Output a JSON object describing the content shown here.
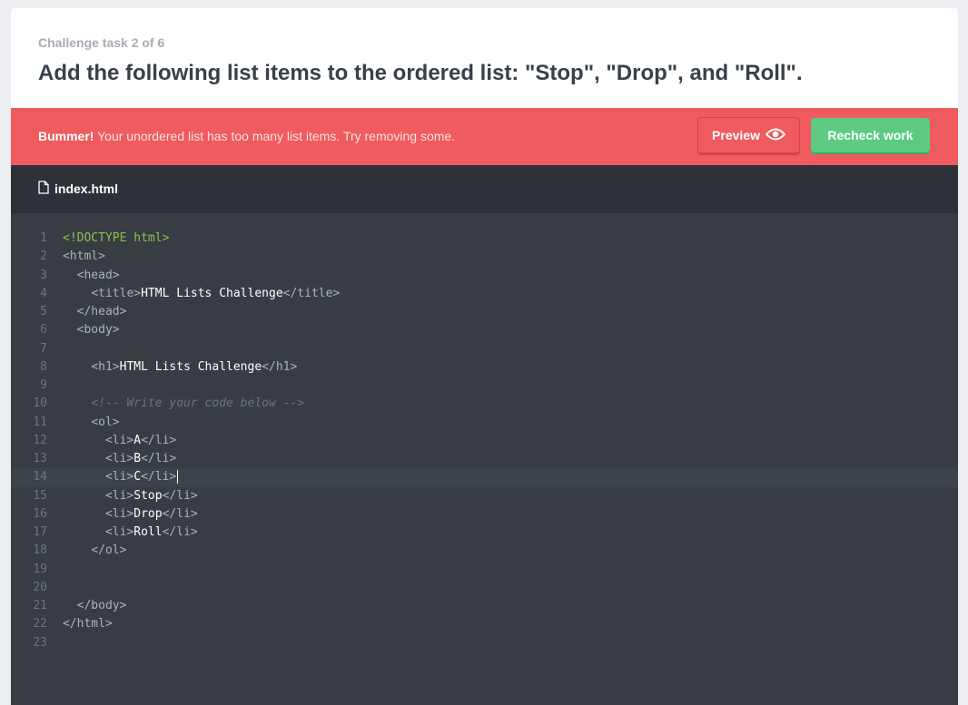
{
  "challenge": {
    "task_label": "Challenge task 2 of 6",
    "title": "Add the following list items to the ordered list: \"Stop\", \"Drop\", and \"Roll\"."
  },
  "alert": {
    "strong": "Bummer!",
    "message": " Your unordered list has too many list items. Try removing some.",
    "preview_label": "Preview",
    "preview_icon": "eye-icon",
    "recheck_label": "Recheck work",
    "color": "#ef5b5e"
  },
  "file": {
    "name": "index.html",
    "icon": "file-icon"
  },
  "editor": {
    "active_line": 14,
    "lines": [
      {
        "n": "1",
        "indent": "",
        "parts": [
          {
            "c": "doc",
            "t": "<!DOCTYPE html>"
          }
        ]
      },
      {
        "n": "2",
        "indent": "",
        "parts": [
          {
            "c": "tag",
            "t": "<html>"
          }
        ]
      },
      {
        "n": "3",
        "indent": "  ",
        "parts": [
          {
            "c": "tag",
            "t": "<head>"
          }
        ]
      },
      {
        "n": "4",
        "indent": "    ",
        "parts": [
          {
            "c": "tag",
            "t": "<title>"
          },
          {
            "c": "txt",
            "t": "HTML Lists Challenge"
          },
          {
            "c": "tag",
            "t": "</title>"
          }
        ]
      },
      {
        "n": "5",
        "indent": "  ",
        "parts": [
          {
            "c": "tag",
            "t": "</head>"
          }
        ]
      },
      {
        "n": "6",
        "indent": "  ",
        "parts": [
          {
            "c": "tag",
            "t": "<body>"
          }
        ]
      },
      {
        "n": "7",
        "indent": "",
        "parts": []
      },
      {
        "n": "8",
        "indent": "    ",
        "parts": [
          {
            "c": "tag",
            "t": "<h1>"
          },
          {
            "c": "txt",
            "t": "HTML Lists Challenge"
          },
          {
            "c": "tag",
            "t": "</h1>"
          }
        ]
      },
      {
        "n": "9",
        "indent": "",
        "parts": []
      },
      {
        "n": "10",
        "indent": "    ",
        "parts": [
          {
            "c": "cmt",
            "t": "<!-- Write your code below -->"
          }
        ]
      },
      {
        "n": "11",
        "indent": "    ",
        "parts": [
          {
            "c": "tag",
            "t": "<ol>"
          }
        ]
      },
      {
        "n": "12",
        "indent": "      ",
        "parts": [
          {
            "c": "tag",
            "t": "<li>"
          },
          {
            "c": "txt",
            "t": "A"
          },
          {
            "c": "tag",
            "t": "</li>"
          }
        ]
      },
      {
        "n": "13",
        "indent": "      ",
        "parts": [
          {
            "c": "tag",
            "t": "<li>"
          },
          {
            "c": "txt",
            "t": "B"
          },
          {
            "c": "tag",
            "t": "</li>"
          }
        ]
      },
      {
        "n": "14",
        "indent": "      ",
        "parts": [
          {
            "c": "tag",
            "t": "<li>"
          },
          {
            "c": "txt",
            "t": "C"
          },
          {
            "c": "tag",
            "t": "</li>"
          }
        ]
      },
      {
        "n": "15",
        "indent": "      ",
        "parts": [
          {
            "c": "tag",
            "t": "<li>"
          },
          {
            "c": "txt",
            "t": "Stop"
          },
          {
            "c": "tag",
            "t": "</li>"
          }
        ]
      },
      {
        "n": "16",
        "indent": "      ",
        "parts": [
          {
            "c": "tag",
            "t": "<li>"
          },
          {
            "c": "txt",
            "t": "Drop"
          },
          {
            "c": "tag",
            "t": "</li>"
          }
        ]
      },
      {
        "n": "17",
        "indent": "      ",
        "parts": [
          {
            "c": "tag",
            "t": "<li>"
          },
          {
            "c": "txt",
            "t": "Roll"
          },
          {
            "c": "tag",
            "t": "</li>"
          }
        ]
      },
      {
        "n": "18",
        "indent": "    ",
        "parts": [
          {
            "c": "tag",
            "t": "</ol>"
          }
        ]
      },
      {
        "n": "19",
        "indent": "",
        "parts": []
      },
      {
        "n": "20",
        "indent": "",
        "parts": []
      },
      {
        "n": "21",
        "indent": "  ",
        "parts": [
          {
            "c": "tag",
            "t": "</body>"
          }
        ]
      },
      {
        "n": "22",
        "indent": "",
        "parts": [
          {
            "c": "tag",
            "t": "</html>"
          }
        ]
      },
      {
        "n": "23",
        "indent": "",
        "parts": []
      }
    ]
  }
}
